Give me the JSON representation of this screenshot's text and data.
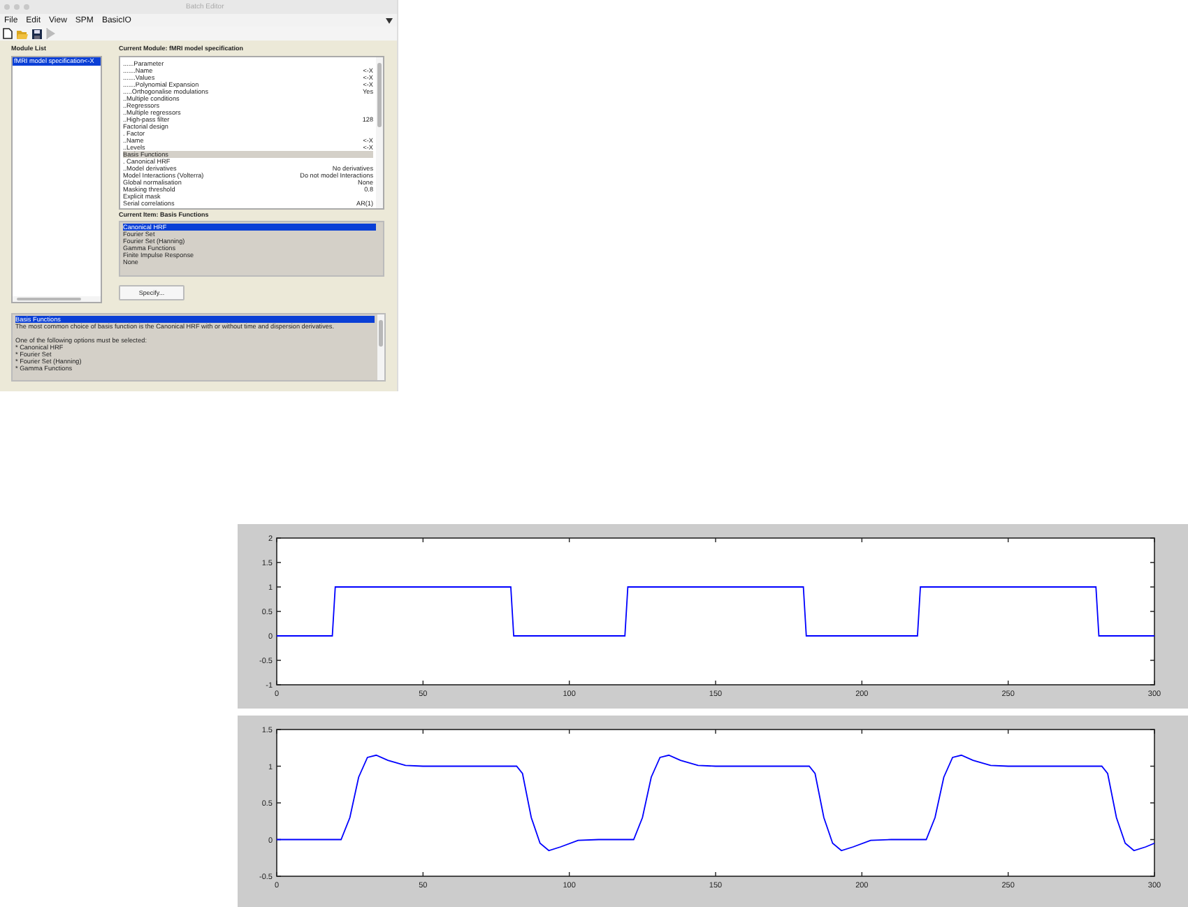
{
  "window": {
    "title": "Batch Editor"
  },
  "menu": [
    "File",
    "Edit",
    "View",
    "SPM",
    "BasicIO"
  ],
  "module_list": {
    "label": "Module List",
    "items": [
      {
        "label": "fMRI model specification<-X",
        "selected": true
      }
    ]
  },
  "current_module": {
    "label": "Current Module: fMRI model specification",
    "rows": [
      {
        "label": "......Parameter",
        "selected": false
      },
      {
        "label": ".......Name",
        "value": "<-X",
        "selected": false
      },
      {
        "label": ".......Values",
        "value": "<-X",
        "selected": false
      },
      {
        "label": ".......Polynomial Expansion",
        "value": "<-X",
        "selected": false
      },
      {
        "label": ".....Orthogonalise modulations",
        "value": "Yes",
        "selected": false
      },
      {
        "label": "..Multiple conditions",
        "selected": false
      },
      {
        "label": "..Regressors",
        "selected": false
      },
      {
        "label": "..Multiple regressors",
        "selected": false
      },
      {
        "label": "..High-pass filter",
        "value": "128",
        "selected": false
      },
      {
        "label": "Factorial design",
        "selected": false
      },
      {
        "label": ". Factor",
        "selected": false
      },
      {
        "label": "..Name",
        "value": "<-X",
        "selected": false
      },
      {
        "label": "..Levels",
        "value": "<-X",
        "selected": false
      },
      {
        "label": "Basis Functions",
        "selected": true
      },
      {
        "label": ". Canonical HRF",
        "selected": false
      },
      {
        "label": "..Model derivatives",
        "value": "No derivatives",
        "selected": false
      },
      {
        "label": "Model Interactions (Volterra)",
        "value": "Do not model Interactions",
        "selected": false
      },
      {
        "label": "Global normalisation",
        "value": "None",
        "selected": false
      },
      {
        "label": "Masking threshold",
        "value": "0.8",
        "selected": false
      },
      {
        "label": "Explicit mask",
        "selected": false
      },
      {
        "label": "Serial correlations",
        "value": "AR(1)",
        "selected": false
      }
    ]
  },
  "current_item": {
    "label": "Current Item: Basis Functions",
    "options": [
      {
        "label": "Canonical HRF",
        "selected": true
      },
      {
        "label": "Fourier Set",
        "selected": false
      },
      {
        "label": "Fourier Set (Hanning)",
        "selected": false
      },
      {
        "label": "Gamma Functions",
        "selected": false
      },
      {
        "label": "Finite Impulse Response",
        "selected": false
      },
      {
        "label": "None",
        "selected": false
      }
    ]
  },
  "specify_button": "Specify...",
  "help": [
    {
      "kind": "heading",
      "text": "Basis Functions",
      "selected": true
    },
    {
      "kind": "paragraph",
      "text": "The most common choice of basis function is the Canonical HRF with or without time and dispersion derivatives."
    },
    {
      "kind": "intro",
      "text": "One of the following options must be selected:"
    },
    {
      "kind": "bullet",
      "text": "* Canonical HRF"
    },
    {
      "kind": "bullet",
      "text": "* Fourier Set"
    },
    {
      "kind": "bullet",
      "text": "* Fourier Set (Hanning)"
    },
    {
      "kind": "bullet",
      "text": "* Gamma Functions"
    }
  ],
  "figures": [
    {
      "chart_data": {
        "type": "line",
        "x": [
          0,
          19,
          20,
          80,
          81,
          119,
          120,
          180,
          181,
          219,
          220,
          280,
          281,
          300
        ],
        "series": [
          {
            "color": "#0000ff",
            "values": [
              0,
              0,
              1,
              1,
              0,
              0,
              1,
              1,
              0,
              0,
              1,
              1,
              0,
              0
            ]
          }
        ],
        "xlim": [
          0,
          300
        ],
        "ylim": [
          -1,
          2
        ],
        "xticks": [
          0,
          50,
          100,
          150,
          200,
          250,
          300
        ],
        "yticks": [
          -1,
          -0.5,
          0,
          0.5,
          1,
          1.5,
          2
        ]
      }
    },
    {
      "chart_data": {
        "type": "line",
        "x": [
          0,
          22,
          25,
          28,
          31,
          34,
          38,
          44,
          50,
          82,
          84,
          87,
          90,
          93,
          97,
          103,
          110,
          122,
          125,
          128,
          131,
          134,
          138,
          144,
          150,
          182,
          184,
          187,
          190,
          193,
          197,
          203,
          210,
          222,
          225,
          228,
          231,
          234,
          238,
          244,
          250,
          282,
          284,
          287,
          290,
          293,
          297,
          300
        ],
        "series": [
          {
            "color": "#0000ff",
            "values": [
              0,
              0,
              0.3,
              0.85,
              1.12,
              1.15,
              1.08,
              1.01,
              1,
              1,
              0.9,
              0.3,
              -0.05,
              -0.15,
              -0.1,
              -0.01,
              0,
              0,
              0.3,
              0.85,
              1.12,
              1.15,
              1.08,
              1.01,
              1,
              1,
              0.9,
              0.3,
              -0.05,
              -0.15,
              -0.1,
              -0.01,
              0,
              0,
              0.3,
              0.85,
              1.12,
              1.15,
              1.08,
              1.01,
              1,
              1,
              0.9,
              0.3,
              -0.05,
              -0.15,
              -0.1,
              -0.05
            ]
          }
        ],
        "xlim": [
          0,
          300
        ],
        "ylim": [
          -0.5,
          1.5
        ],
        "xticks": [
          0,
          50,
          100,
          150,
          200,
          250,
          300
        ],
        "yticks": [
          -0.5,
          0,
          0.5,
          1,
          1.5
        ]
      }
    }
  ]
}
